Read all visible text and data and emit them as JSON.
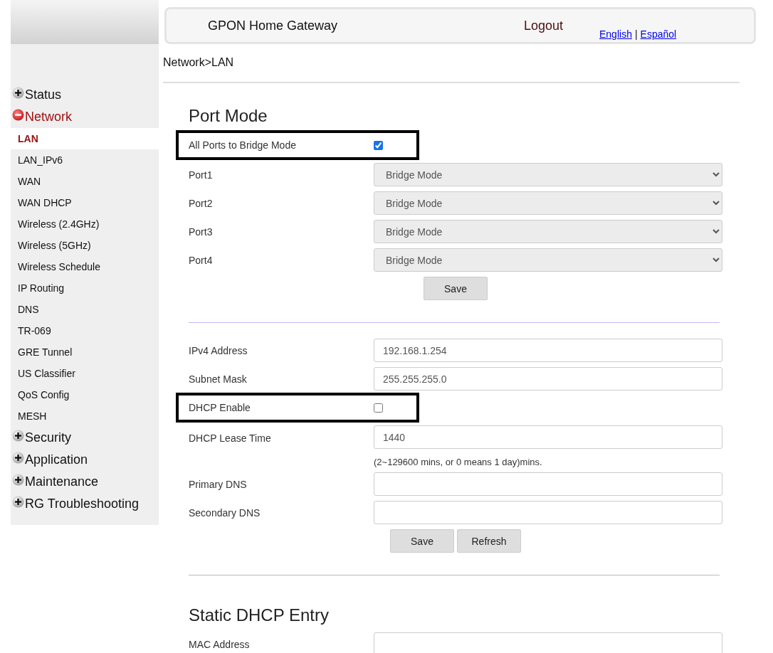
{
  "header": {
    "title": "GPON Home Gateway",
    "logout": "Logout",
    "languages": [
      "English",
      "Español"
    ],
    "separator": "|"
  },
  "breadcrumb": "Network>LAN",
  "sidebar": {
    "items": [
      {
        "label": "Status",
        "expanded": false
      },
      {
        "label": "Network",
        "expanded": true,
        "children": [
          {
            "label": "LAN",
            "selected": true
          },
          {
            "label": "LAN_IPv6",
            "selected": false
          },
          {
            "label": "WAN",
            "selected": false
          },
          {
            "label": "WAN DHCP",
            "selected": false
          },
          {
            "label": "Wireless (2.4GHz)",
            "selected": false
          },
          {
            "label": "Wireless (5GHz)",
            "selected": false
          },
          {
            "label": "Wireless Schedule",
            "selected": false
          },
          {
            "label": "IP Routing",
            "selected": false
          },
          {
            "label": "DNS",
            "selected": false
          },
          {
            "label": "TR-069",
            "selected": false
          },
          {
            "label": "GRE Tunnel",
            "selected": false
          },
          {
            "label": "US Classifier",
            "selected": false
          },
          {
            "label": "QoS Config",
            "selected": false
          },
          {
            "label": "MESH",
            "selected": false
          }
        ]
      },
      {
        "label": "Security",
        "expanded": false
      },
      {
        "label": "Application",
        "expanded": false
      },
      {
        "label": "Maintenance",
        "expanded": false
      },
      {
        "label": "RG Troubleshooting",
        "expanded": false
      }
    ]
  },
  "sections": [
    {
      "title": "Port Mode",
      "rows": [
        {
          "kind": "checkbox",
          "label": "All Ports to Bridge Mode",
          "checked": true,
          "highlighted": true
        },
        {
          "kind": "select",
          "label": "Port1",
          "value": "Bridge Mode"
        },
        {
          "kind": "select",
          "label": "Port2",
          "value": "Bridge Mode"
        },
        {
          "kind": "select",
          "label": "Port3",
          "value": "Bridge Mode"
        },
        {
          "kind": "select",
          "label": "Port4",
          "value": "Bridge Mode"
        },
        {
          "kind": "buttons",
          "buttons": [
            "Save"
          ]
        }
      ]
    },
    {
      "rows": [
        {
          "kind": "input",
          "label": "IPv4 Address",
          "value": "192.168.1.254"
        },
        {
          "kind": "input",
          "label": "Subnet Mask",
          "value": "255.255.255.0"
        },
        {
          "kind": "checkbox",
          "label": "DHCP Enable",
          "checked": false,
          "highlighted": true
        },
        {
          "kind": "input",
          "label": "DHCP Lease Time",
          "value": "1440",
          "note": "(2~129600 mins, or 0 means 1 day)mins."
        },
        {
          "kind": "input",
          "label": "Primary DNS"
        },
        {
          "kind": "input",
          "label": "Secondary DNS"
        },
        {
          "kind": "buttons",
          "buttons": [
            "Save",
            "Refresh"
          ]
        }
      ]
    },
    {
      "title": "Static DHCP Entry",
      "rows": [
        {
          "kind": "input",
          "label": "MAC Address"
        }
      ]
    }
  ]
}
